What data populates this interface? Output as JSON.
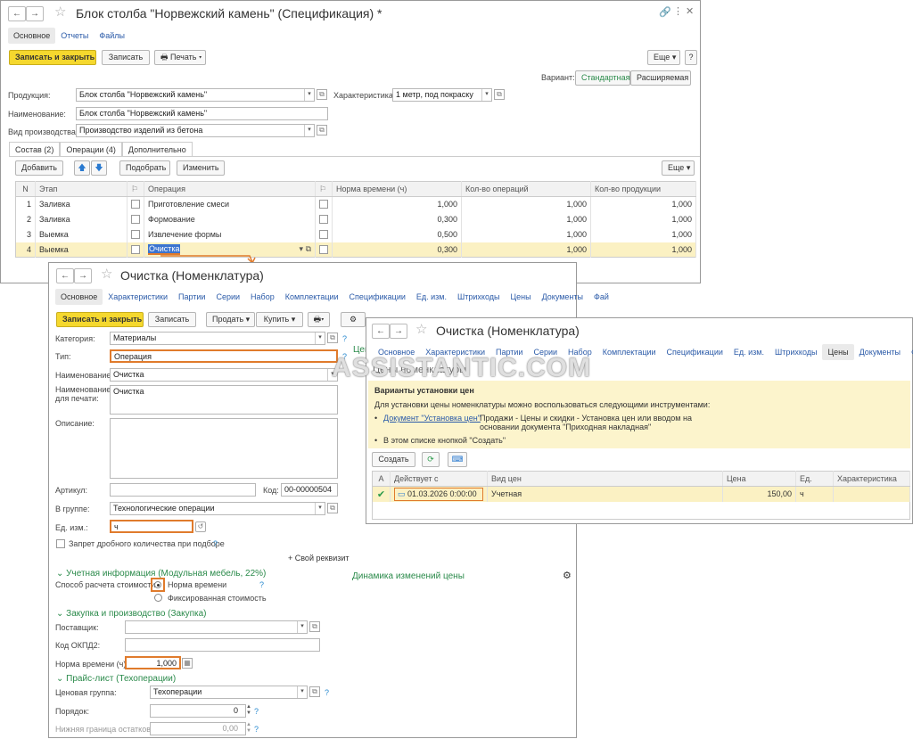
{
  "w1": {
    "title": "Блок столба \"Норвежский камень\" (Спецификация) *",
    "tabs": [
      "Основное",
      "Отчеты",
      "Файлы"
    ],
    "save_close": "Записать и закрыть",
    "save": "Записать",
    "print": "Печать",
    "more": "Еще",
    "help": "?",
    "variant_label": "Вариант:",
    "variant_std": "Стандартная",
    "variant_ext": "Расширяемая",
    "product_label": "Продукция:",
    "product_value": "Блок столба \"Норвежский камень\"",
    "char_label": "Характеристика:",
    "char_value": "1 метр, под покраску",
    "name_label": "Наименование:",
    "name_value": "Блок столба \"Норвежский камень\"",
    "prod_type_label": "Вид производства:",
    "prod_type_value": "Производство изделий из бетона",
    "inner_tabs": [
      "Состав (2)",
      "Операции (4)",
      "Дополнительно"
    ],
    "add": "Добавить",
    "pick": "Подобрать",
    "change": "Изменить",
    "more2": "Еще",
    "cols": [
      "N",
      "Этап",
      "Операция",
      "Норма времени (ч)",
      "Кол-во операций",
      "Кол-во продукции"
    ],
    "rows": [
      {
        "n": "1",
        "stage": "Заливка",
        "op": "Приготовление смеси",
        "norm": "1,000",
        "ops": "1,000",
        "prod": "1,000"
      },
      {
        "n": "2",
        "stage": "Заливка",
        "op": "Формование",
        "norm": "0,300",
        "ops": "1,000",
        "prod": "1,000"
      },
      {
        "n": "3",
        "stage": "Выемка",
        "op": "Извлечение формы",
        "norm": "0,500",
        "ops": "1,000",
        "prod": "1,000"
      },
      {
        "n": "4",
        "stage": "Выемка",
        "op": "Очистка",
        "norm": "0,300",
        "ops": "1,000",
        "prod": "1,000"
      }
    ]
  },
  "w2": {
    "title": "Очистка (Номенклатура)",
    "tabs": [
      "Основное",
      "Характеристики",
      "Партии",
      "Серии",
      "Набор",
      "Комплектации",
      "Спецификации",
      "Ед. изм.",
      "Штрихкоды",
      "Цены",
      "Документы",
      "Фай"
    ],
    "save_close": "Записать и закрыть",
    "save": "Записать",
    "sell": "Продать",
    "buy": "Купить",
    "category_label": "Категория:",
    "category_value": "Материалы",
    "type_label": "Тип:",
    "type_value": "Операция",
    "name_label": "Наименование:",
    "name_value": "Очистка",
    "print_name_label1": "Наименование",
    "print_name_label2": "для печати:",
    "print_name_value": "Очистка",
    "desc_label": "Описание:",
    "article_label": "Артикул:",
    "code_label": "Код:",
    "code_value": "00-00000504",
    "group_label": "В группе:",
    "group_value": "Технологические операции",
    "unit_label": "Ед. изм.:",
    "unit_value": "ч",
    "no_fraction": "Запрет дробного количества при подборе",
    "own_prop": "+ Свой реквизит",
    "acc_group": "Учетная информация (Модульная мебель, 22%)",
    "cost_method_label": "Способ расчета стоимости:",
    "cost_norm": "Норма времени",
    "cost_fixed": "Фиксированная стоимость",
    "purchase_group": "Закупка и производство (Закупка)",
    "supplier_label": "Поставщик:",
    "okpd_label": "Код ОКПД2:",
    "norm_label": "Норма времени (ч):",
    "norm_value": "1,000",
    "price_group": "Прайс-лист (Техоперации)",
    "price_grp_label": "Ценовая группа:",
    "price_grp_value": "Техоперации",
    "order_label": "Порядок:",
    "order_value": "0",
    "min_stock_label": "Нижняя граница остатков:",
    "min_stock_value": "0,00",
    "dynamics": "Динамика изменений цены",
    "cen_partial": "Цен"
  },
  "w3": {
    "title": "Очистка (Номенклатура)",
    "tabs": [
      "Основное",
      "Характеристики",
      "Партии",
      "Серии",
      "Набор",
      "Комплектации",
      "Спецификации",
      "Ед. изм.",
      "Штрихкоды",
      "Цены",
      "Документы",
      "Файлы"
    ],
    "subtitle": "Цены номенклатуры",
    "info_title": "Варианты установки цен",
    "info_text": "Для установки цены номенклатуры можно воспользоваться следующими инструментами:",
    "doc_link": "Документ \"Установка цен\"",
    "doc_desc1": "Продажи - Цены и скидки - Установка цен или вводом на",
    "doc_desc2": "основании документа \"Приходная накладная\"",
    "list_hint": "В этом списке кнопкой \"Создать\"",
    "create": "Создать",
    "cols": [
      "А",
      "Действует с",
      "Вид цен",
      "Цена",
      "Ед.",
      "Характеристика"
    ],
    "row": {
      "date": "01.03.2026 0:00:00",
      "kind": "Учетная",
      "price": "150,00",
      "unit": "ч"
    }
  },
  "watermark": "ASSISTANTIC.COM",
  "colors": {
    "accent": "#f5d82e",
    "highlight": "#e07b2c",
    "link": "#2a5aa8",
    "group": "#2a8a4a"
  }
}
